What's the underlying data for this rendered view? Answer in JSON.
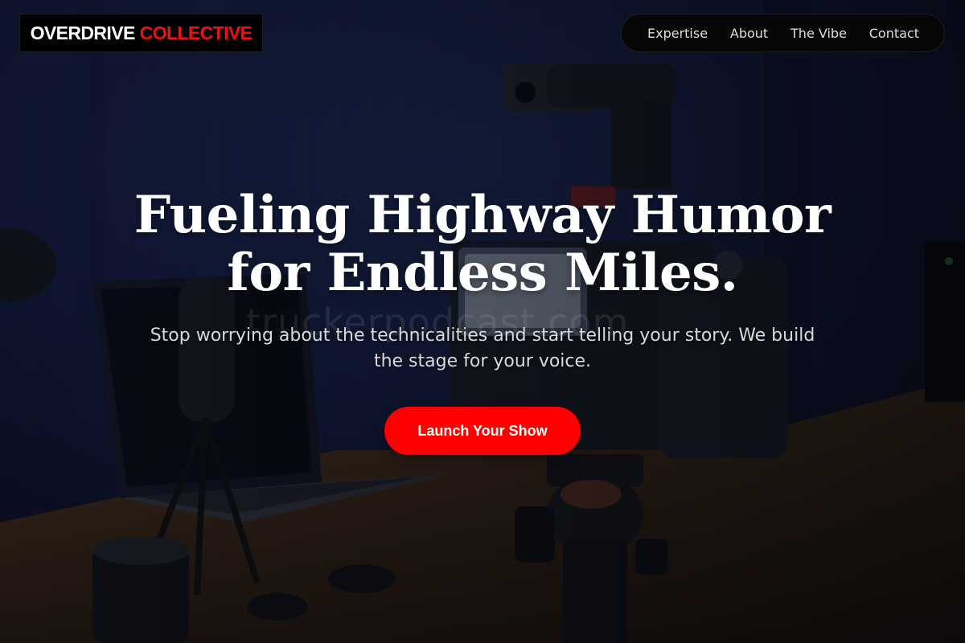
{
  "brand": {
    "word1": "OVERDRIVE",
    "word2": "COLLECTIVE",
    "accent_color": "#ee1111"
  },
  "nav": {
    "items": [
      {
        "label": "Expertise"
      },
      {
        "label": "About"
      },
      {
        "label": "The Vibe"
      },
      {
        "label": "Contact"
      }
    ]
  },
  "hero": {
    "headline_line1": "Fueling Highway Humor",
    "headline_line2": "for Endless Miles.",
    "subtext": "Stop worrying about the technicalities and start telling your story. We build the stage for your voice.",
    "cta_label": "Launch Your Show",
    "cta_color": "#ff0000",
    "watermark": "truckerpodcast.com"
  },
  "background": {
    "subject": "camera-on-tripod-at-desk-with-laptop-and-microphone"
  }
}
